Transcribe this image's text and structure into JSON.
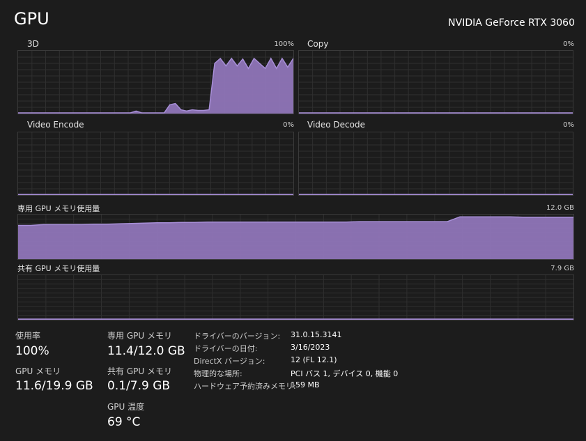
{
  "header": {
    "title": "GPU",
    "gpu_name": "NVIDIA GeForce RTX 3060"
  },
  "graphs": {
    "d3": {
      "label": "3D",
      "max": "100%",
      "utilization": [
        0,
        0,
        0,
        0,
        0,
        0,
        0,
        0,
        0,
        0,
        0,
        1,
        0,
        0,
        0,
        0,
        0,
        0,
        0,
        0,
        0,
        4,
        0,
        0,
        0,
        1,
        0,
        14,
        16,
        6,
        4,
        6,
        5,
        5,
        6,
        80,
        88,
        76,
        88,
        76,
        87,
        72,
        88,
        80,
        72,
        88,
        72,
        88,
        74,
        88
      ]
    },
    "copy": {
      "label": "Copy",
      "max": "0%"
    },
    "video_encode": {
      "label": "Video Encode",
      "max": "0%"
    },
    "video_decode": {
      "label": "Video Decode",
      "max": "0%"
    },
    "dedicated": {
      "label": "専用 GPU メモリ使用量",
      "max": "12.0 GB",
      "usage_gb": [
        9.1,
        9.1,
        9.3,
        9.3,
        9.3,
        9.3,
        9.4,
        9.4,
        9.5,
        9.6,
        9.7,
        9.8,
        9.8,
        9.9,
        9.9,
        10.0,
        10.0,
        10.0,
        10.0,
        10.0,
        10.0,
        10.0,
        10.0,
        10.0,
        10.0,
        10.0,
        10.0,
        10.1,
        10.1,
        10.1,
        10.1,
        10.1,
        10.1,
        10.1,
        10.1,
        11.4,
        11.4,
        11.4,
        11.4,
        11.4,
        11.3,
        11.3,
        11.3,
        11.3,
        11.3
      ]
    },
    "shared": {
      "label": "共有 GPU メモリ使用量",
      "max": "7.9 GB",
      "usage_gb": [
        0.1,
        0.1,
        0.1,
        0.1,
        0.1,
        0.1,
        0.1,
        0.1,
        0.1,
        0.1,
        0.1,
        0.1,
        0.1,
        0.1,
        0.1,
        0.1,
        0.1,
        0.1,
        0.1,
        0.1,
        0.1,
        0.1,
        0.1,
        0.1,
        0.1,
        0.1,
        0.1,
        0.1,
        0.1,
        0.1,
        0.1,
        0.1,
        0.05,
        0.1,
        0.1,
        0.1,
        0.1,
        0.1,
        0.1,
        0.1,
        0.1,
        0.1,
        0.1,
        0.1,
        0.1
      ]
    }
  },
  "stats": {
    "utilization_label": "使用率",
    "utilization_value": "100%",
    "dedicated_label": "専用 GPU メモリ",
    "dedicated_value": "11.4/12.0 GB",
    "gpu_memory_label": "GPU メモリ",
    "gpu_memory_value": "11.6/19.9 GB",
    "shared_label": "共有 GPU メモリ",
    "shared_value": "0.1/7.9 GB",
    "temp_label": "GPU 温度",
    "temp_value": "69 °C"
  },
  "info": {
    "driver_version_label": "ドライバーのバージョン:",
    "driver_version_value": "31.0.15.3141",
    "driver_date_label": "ドライバーの日付:",
    "driver_date_value": "3/16/2023",
    "directx_label": "DirectX バージョン:",
    "directx_value": "12 (FL 12.1)",
    "location_label": "物理的な場所:",
    "location_value": "PCI バス 1, デバイス 0, 機能 0",
    "reserved_label": "ハードウェア予約済みメモリ:",
    "reserved_value": "159 MB"
  },
  "colors": {
    "graph_fill": "#8f75b8",
    "graph_line": "#a88fd8",
    "grid": "#2f2f2f"
  }
}
